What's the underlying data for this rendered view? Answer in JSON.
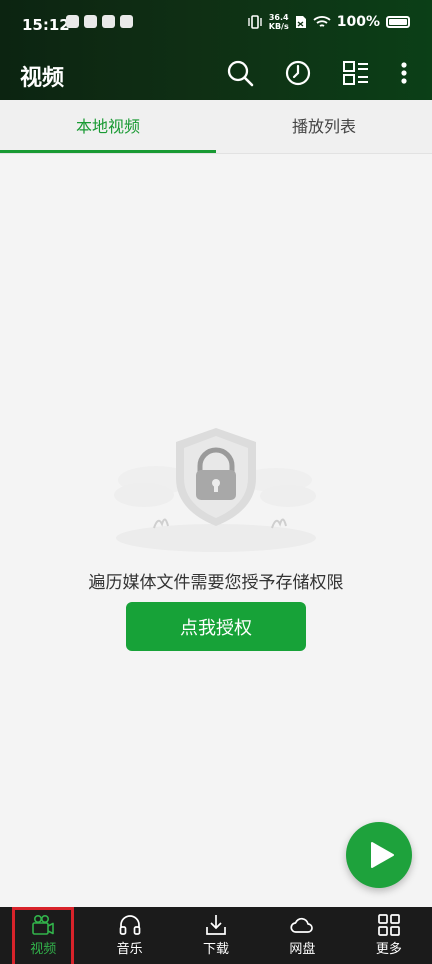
{
  "status_bar": {
    "time": "15:12",
    "network_speed": "36.4",
    "network_speed_unit": "KB/s",
    "battery": "100%"
  },
  "app_bar": {
    "title": "视频",
    "icons": [
      "search-icon",
      "history-icon",
      "grid-list-icon",
      "more-vertical-icon"
    ]
  },
  "tabs": [
    {
      "label": "本地视频",
      "active": true
    },
    {
      "label": "播放列表",
      "active": false
    }
  ],
  "empty_state": {
    "message": "遍历媒体文件需要您授予存储权限",
    "button_label": "点我授权"
  },
  "bottom_nav": [
    {
      "label": "视频",
      "icon": "video-camera-icon",
      "active": true
    },
    {
      "label": "音乐",
      "icon": "headphones-icon",
      "active": false
    },
    {
      "label": "下载",
      "icon": "download-icon",
      "active": false
    },
    {
      "label": "网盘",
      "icon": "cloud-icon",
      "active": false
    },
    {
      "label": "更多",
      "icon": "grid-icon",
      "active": false
    }
  ],
  "colors": {
    "accent": "#199a33",
    "button": "#17a238",
    "header_bg": "#0f2f14",
    "nav_bg": "#1b1b1b"
  }
}
